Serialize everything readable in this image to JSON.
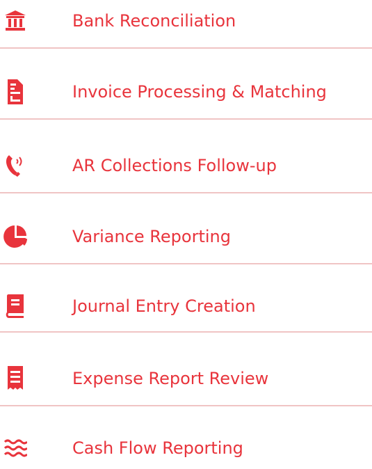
{
  "colors": {
    "accent": "#e8343c",
    "divider": "#f0c4c4",
    "background": "#ffffff"
  },
  "menu": {
    "items": [
      {
        "label": "Bank Reconciliation",
        "icon": "bank-icon"
      },
      {
        "label": "Invoice Processing & Matching",
        "icon": "invoice-icon"
      },
      {
        "label": "AR Collections Follow-up",
        "icon": "phone-icon"
      },
      {
        "label": "Variance Reporting",
        "icon": "pie-chart-icon"
      },
      {
        "label": "Journal Entry Creation",
        "icon": "book-icon"
      },
      {
        "label": "Expense Report Review",
        "icon": "receipt-icon"
      },
      {
        "label": "Cash Flow Reporting",
        "icon": "water-waves-icon"
      }
    ]
  }
}
